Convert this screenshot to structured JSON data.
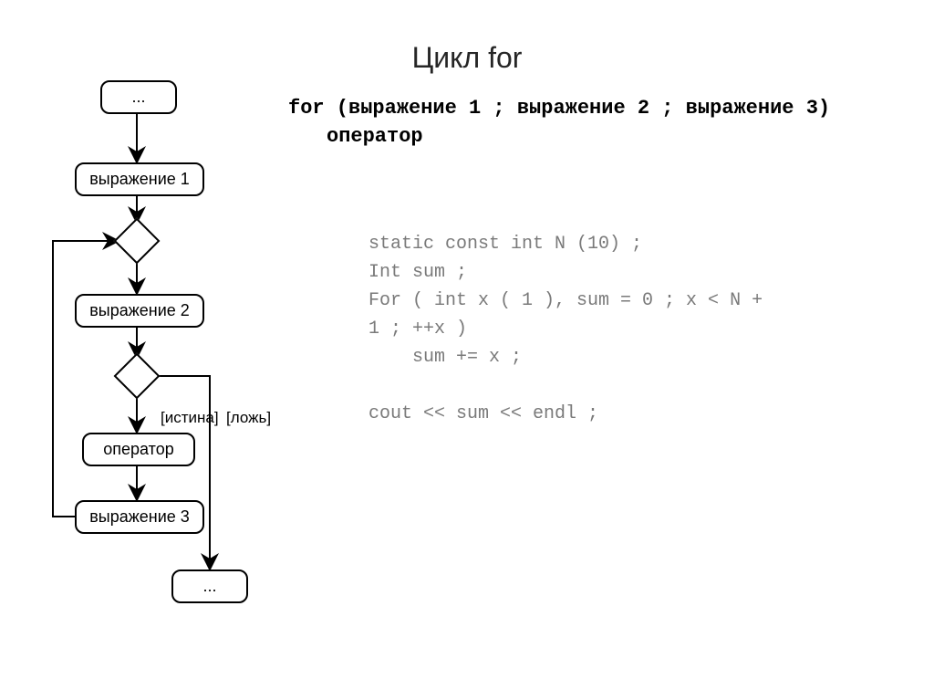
{
  "title": "Цикл for",
  "syntax": {
    "line1": "for (выражение 1 ; выражение 2 ; выражение 3)",
    "line2": "оператор"
  },
  "code": "static const int N (10) ;\nInt sum ;\nFor ( int x ( 1 ), sum = 0 ; x < N +\n1 ; ++x )\n    sum += x ;\n\ncout << sum << endl ;",
  "flowchart": {
    "start": "...",
    "expr1": "выражение 1",
    "expr2": "выражение 2",
    "operator": "оператор",
    "expr3": "выражение 3",
    "end": "...",
    "true_label": "[истина]",
    "false_label": "[ложь]"
  }
}
